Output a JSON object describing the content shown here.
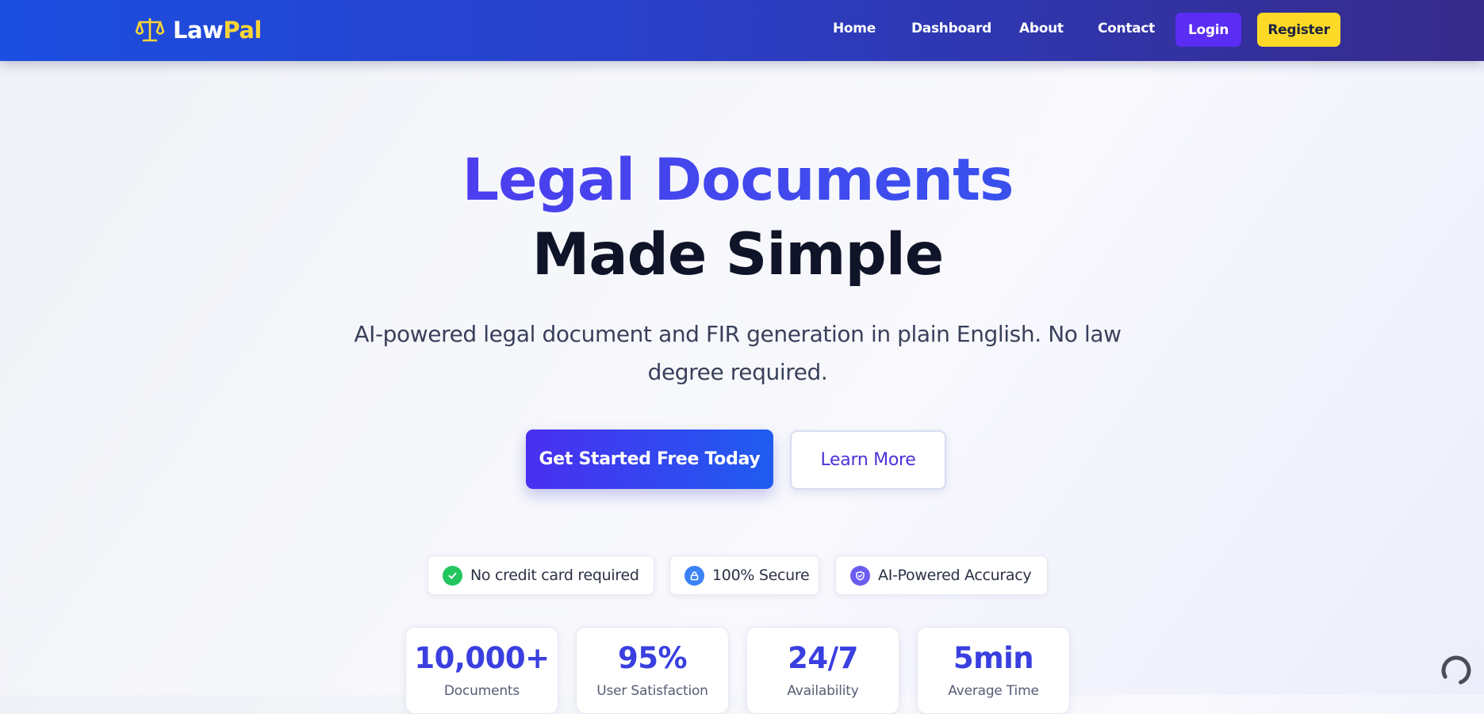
{
  "header": {
    "brand_part1": "Law",
    "brand_part2": "Pal",
    "nav": [
      "Home",
      "Dashboard",
      "About",
      "Contact"
    ],
    "login_label": "Login",
    "register_label": "Register"
  },
  "hero": {
    "title_line1": "Legal Documents",
    "title_line2": "Made Simple",
    "subtitle_line1": "AI-powered legal document and FIR generation in plain English. No law",
    "subtitle_line2": "degree required.",
    "primary_cta": "Get Started Free Today",
    "secondary_cta": "Learn More"
  },
  "badges": [
    {
      "label": "No credit card required",
      "icon": "check-icon",
      "color": "#22c55e"
    },
    {
      "label": "100% Secure",
      "icon": "lock-icon",
      "color": "#3b82f6"
    },
    {
      "label": "AI-Powered Accuracy",
      "icon": "shield-icon",
      "color": "#6b5cf0"
    }
  ],
  "stats": [
    {
      "value": "10,000+",
      "label": "Documents"
    },
    {
      "value": "95%",
      "label": "User Satisfaction"
    },
    {
      "value": "24/7",
      "label": "Availability"
    },
    {
      "value": "5min",
      "label": "Average Time"
    }
  ],
  "colors": {
    "nav_gradient_start": "#1c4ee0",
    "nav_gradient_end": "#372a8a",
    "accent_purple": "#5b2cf3",
    "accent_yellow": "#fbd926",
    "title_gradient_start": "#5b2ff0",
    "title_gradient_end": "#2a60ec",
    "heading_dark": "#0f1428"
  }
}
